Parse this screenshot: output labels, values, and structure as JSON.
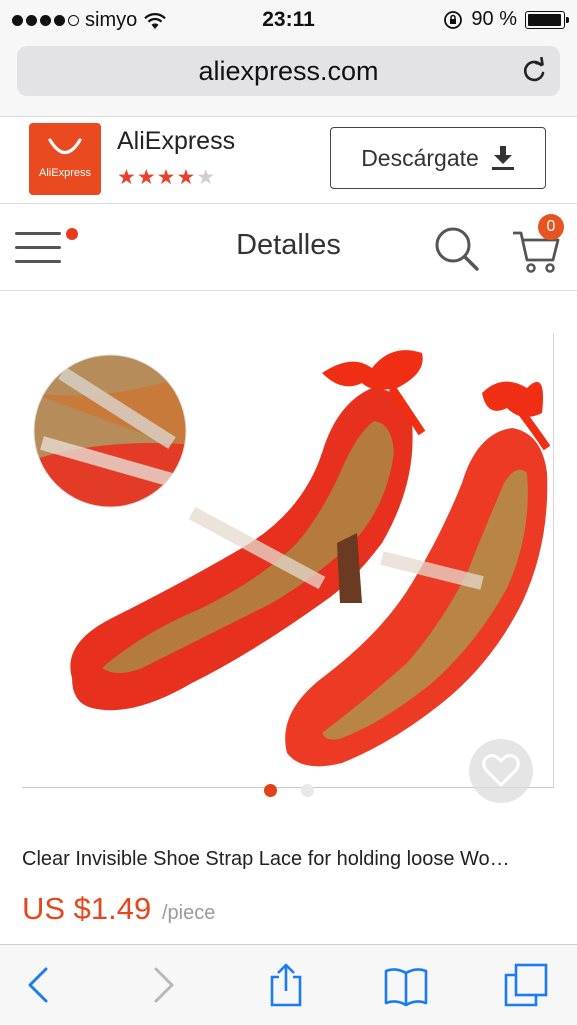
{
  "status_bar": {
    "carrier": "simyo",
    "time": "23:11",
    "battery": "90 %",
    "signal_bars": 4
  },
  "browser": {
    "url": "aliexpress.com"
  },
  "app_banner": {
    "app_name": "AliExpress",
    "logo_text": "AliExpress",
    "rating_stars": 3.5,
    "download_label": "Descárgate"
  },
  "header": {
    "title": "Detalles",
    "cart_count": "0"
  },
  "product": {
    "title": "Clear Invisible Shoe Strap Lace for holding loose Wo…",
    "price": "US $1.49",
    "unit": "/piece",
    "image_count": 2,
    "active_image": 0
  },
  "colors": {
    "accent": "#e8461d",
    "brand": "#ea4a1f"
  }
}
